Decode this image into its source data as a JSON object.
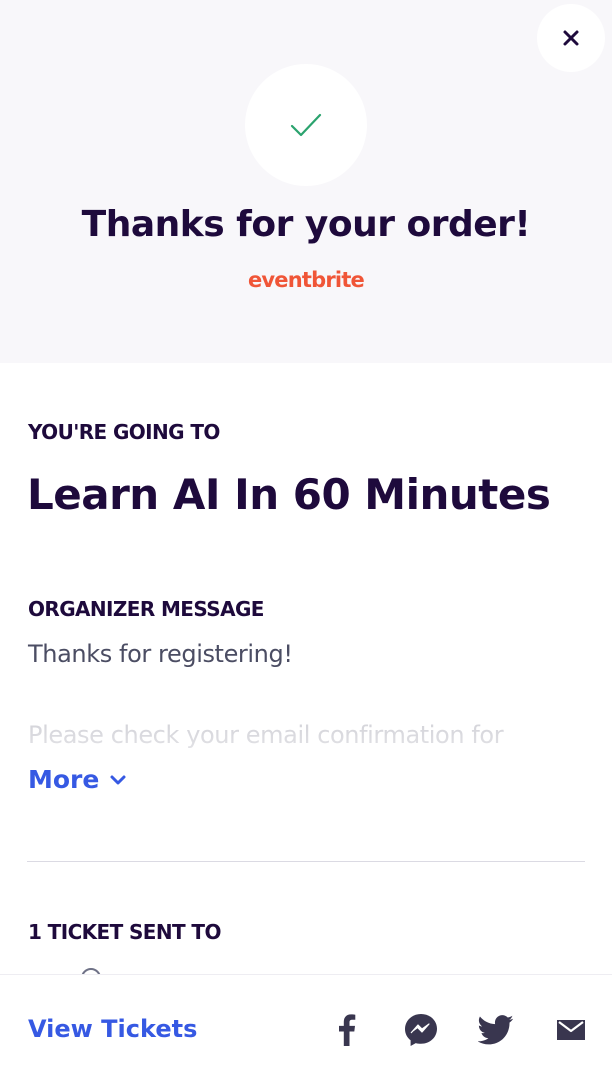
{
  "header": {
    "title": "Thanks for your order!",
    "brand": "eventbrite",
    "close_icon": "close-icon",
    "check_icon": "checkmark-icon",
    "accent_color": "#f05537",
    "check_color": "#2ba36e"
  },
  "event": {
    "going_label": "YOU'RE GOING TO",
    "title": "Learn AI In 60 Minutes"
  },
  "organizer": {
    "label": "ORGANIZER MESSAGE",
    "message_line1": "Thanks for registering!",
    "message_line2": "Please check your email confirmation for",
    "more_label": "More",
    "more_icon": "chevron-down-icon"
  },
  "tickets": {
    "label": "1 TICKET SENT TO"
  },
  "footer": {
    "view_tickets_label": "View Tickets",
    "share_icons": [
      "facebook-icon",
      "messenger-icon",
      "twitter-icon",
      "email-icon"
    ],
    "link_color": "#3659e3"
  }
}
